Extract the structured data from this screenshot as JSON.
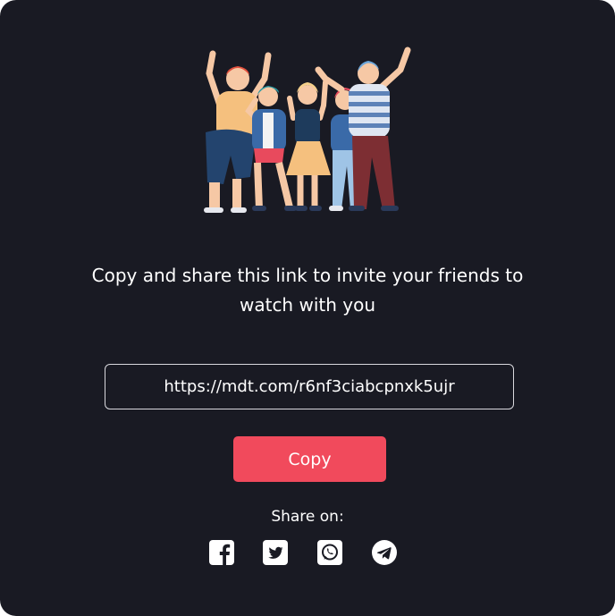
{
  "invite": {
    "message": "Copy and share this link to invite your friends to watch with you",
    "link": "https://mdt.com/r6nf3ciabcpnxk5ujr",
    "copy_label": "Copy",
    "share_label": "Share on:"
  },
  "share_icons": [
    "facebook-icon",
    "twitter-icon",
    "whatsapp-icon",
    "telegram-icon"
  ],
  "colors": {
    "background": "#191a23",
    "accent": "#f14a5c",
    "text": "#ffffff",
    "border": "#d9d9de"
  }
}
